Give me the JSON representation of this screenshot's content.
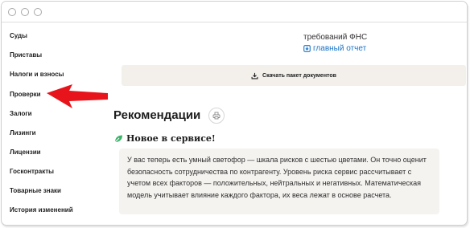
{
  "sidebar": {
    "items": [
      {
        "label": "Суды"
      },
      {
        "label": "Приставы"
      },
      {
        "label": "Налоги и взносы"
      },
      {
        "label": "Проверки"
      },
      {
        "label": "Залоги"
      },
      {
        "label": "Лизинги"
      },
      {
        "label": "Лицензии"
      },
      {
        "label": "Госконтракты"
      },
      {
        "label": "Товарные знаки"
      },
      {
        "label": "История изменений"
      }
    ]
  },
  "main": {
    "requirements_text": "требований ФНС",
    "report_link": "главный отчет",
    "download_label": "Скачать пакет документов",
    "recommendations_title": "Рекомендации",
    "new_title": "Новое в сервисе!",
    "info_text": "У вас теперь есть умный светофор — шкала рисков с шестью цветами. Он точно оценит безопасность сотрудничества по контрагенту. Уровень риска сервис рассчитывает с учетом всех факторов — положительных, нейтральных и негативных. Математическая модель учитывает влияние каждого фактора, их веса лежат в основе расчета."
  },
  "colors": {
    "link": "#1a73c7",
    "arrow": "#e8141b",
    "leaf": "#3cb56a",
    "panel": "#f3f0ec"
  },
  "icons": [
    "download-icon",
    "print-icon",
    "leaf-icon",
    "red-arrow-icon"
  ]
}
